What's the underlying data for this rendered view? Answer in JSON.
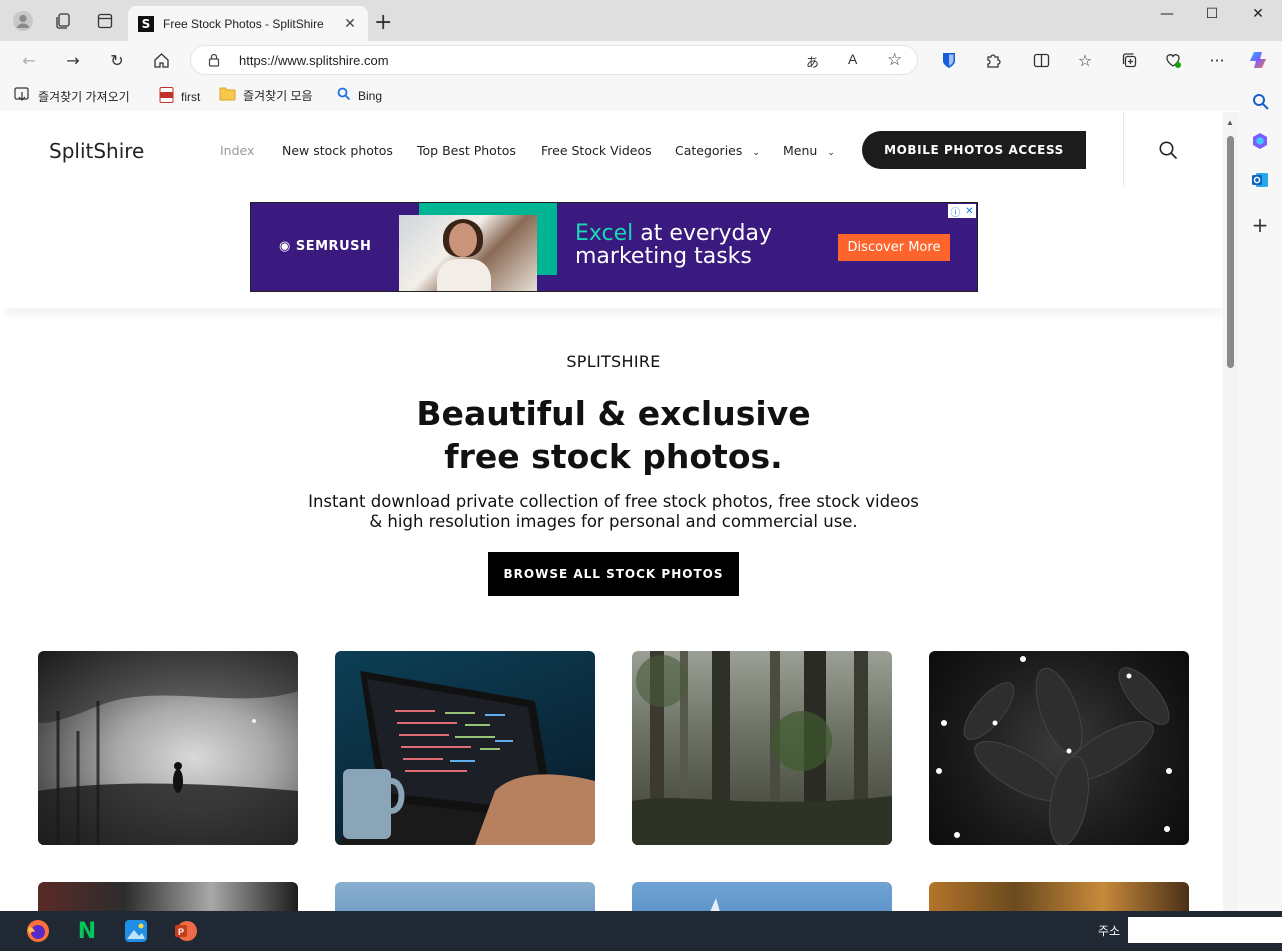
{
  "browser": {
    "tab_title": "Free Stock Photos - SplitShire",
    "tab_favicon_letter": "S",
    "url": "https://www.splitshire.com",
    "favorites": [
      {
        "label": "즐겨찾기 가져오기",
        "icon": "import-icon"
      },
      {
        "label": "first",
        "icon": "pdf-icon"
      },
      {
        "label": "즐겨찾기 모음",
        "icon": "folder-icon"
      },
      {
        "label": "Bing",
        "icon": "bing-icon"
      }
    ]
  },
  "site": {
    "logo": "SplitShire",
    "nav": [
      {
        "label": "Index",
        "active": true
      },
      {
        "label": "New stock photos"
      },
      {
        "label": "Top Best Photos"
      },
      {
        "label": "Free Stock Videos"
      },
      {
        "label": "Categories",
        "dropdown": true
      },
      {
        "label": "Menu",
        "dropdown": true
      }
    ],
    "cta": "MOBILE PHOTOS ACCESS"
  },
  "ad": {
    "brand": "SEMRUSH",
    "headline_accent": "Excel",
    "headline_rest": "at everyday",
    "headline_line2": "marketing tasks",
    "button": "Discover More"
  },
  "hero": {
    "eyebrow": "SPLITSHIRE",
    "title_line1": "Beautiful & exclusive",
    "title_line2": "free stock photos.",
    "subtitle_line1": "Instant download private collection of free stock photos, free stock videos",
    "subtitle_line2": "& high resolution images for personal and commercial use.",
    "button": "BROWSE ALL STOCK PHOTOS"
  },
  "photos": [
    {
      "subject": "foggy street silhouette"
    },
    {
      "subject": "laptop with code and mug"
    },
    {
      "subject": "misty forest"
    },
    {
      "subject": "dark plant with white flowers"
    },
    {
      "subject": "vintage car"
    },
    {
      "subject": "blue sky"
    },
    {
      "subject": "blue sky plane"
    },
    {
      "subject": "autumn forest"
    }
  ],
  "taskbar": {
    "address_label": "주소"
  },
  "colors": {
    "ad_purple": "#3b1a80",
    "ad_green": "#00b594",
    "ad_orange": "#ff642d",
    "cta_dark": "#1c1c1c"
  }
}
